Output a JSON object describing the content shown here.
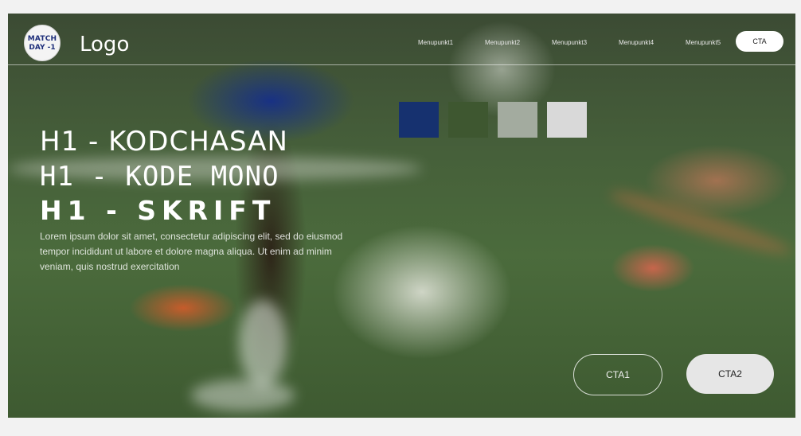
{
  "nav": {
    "badge_line1": "MATCH",
    "badge_line2": "DAY -1",
    "logo_text": "Logo",
    "menu": [
      "Menupunkt1",
      "Menupunkt2",
      "Menupunkt3",
      "Menupunkt4",
      "Menupunkt5"
    ],
    "cta": "CTA"
  },
  "swatches": {
    "colors": [
      "#16316f",
      "#3e5730",
      "#a3ab9f",
      "#d9d9d9"
    ]
  },
  "hero": {
    "heading1": "H1 - KODCHASAN",
    "heading2": "H1 - KODE MONO",
    "heading3": "H1 - SKRIFT",
    "body": "Lorem ipsum dolor sit amet, consectetur adipiscing elit, sed do eiusmod tempor incididunt ut labore et dolore magna aliqua. Ut enim ad minim veniam, quis nostrud exercitation",
    "cta1": "CTA1",
    "cta2": "CTA2"
  }
}
